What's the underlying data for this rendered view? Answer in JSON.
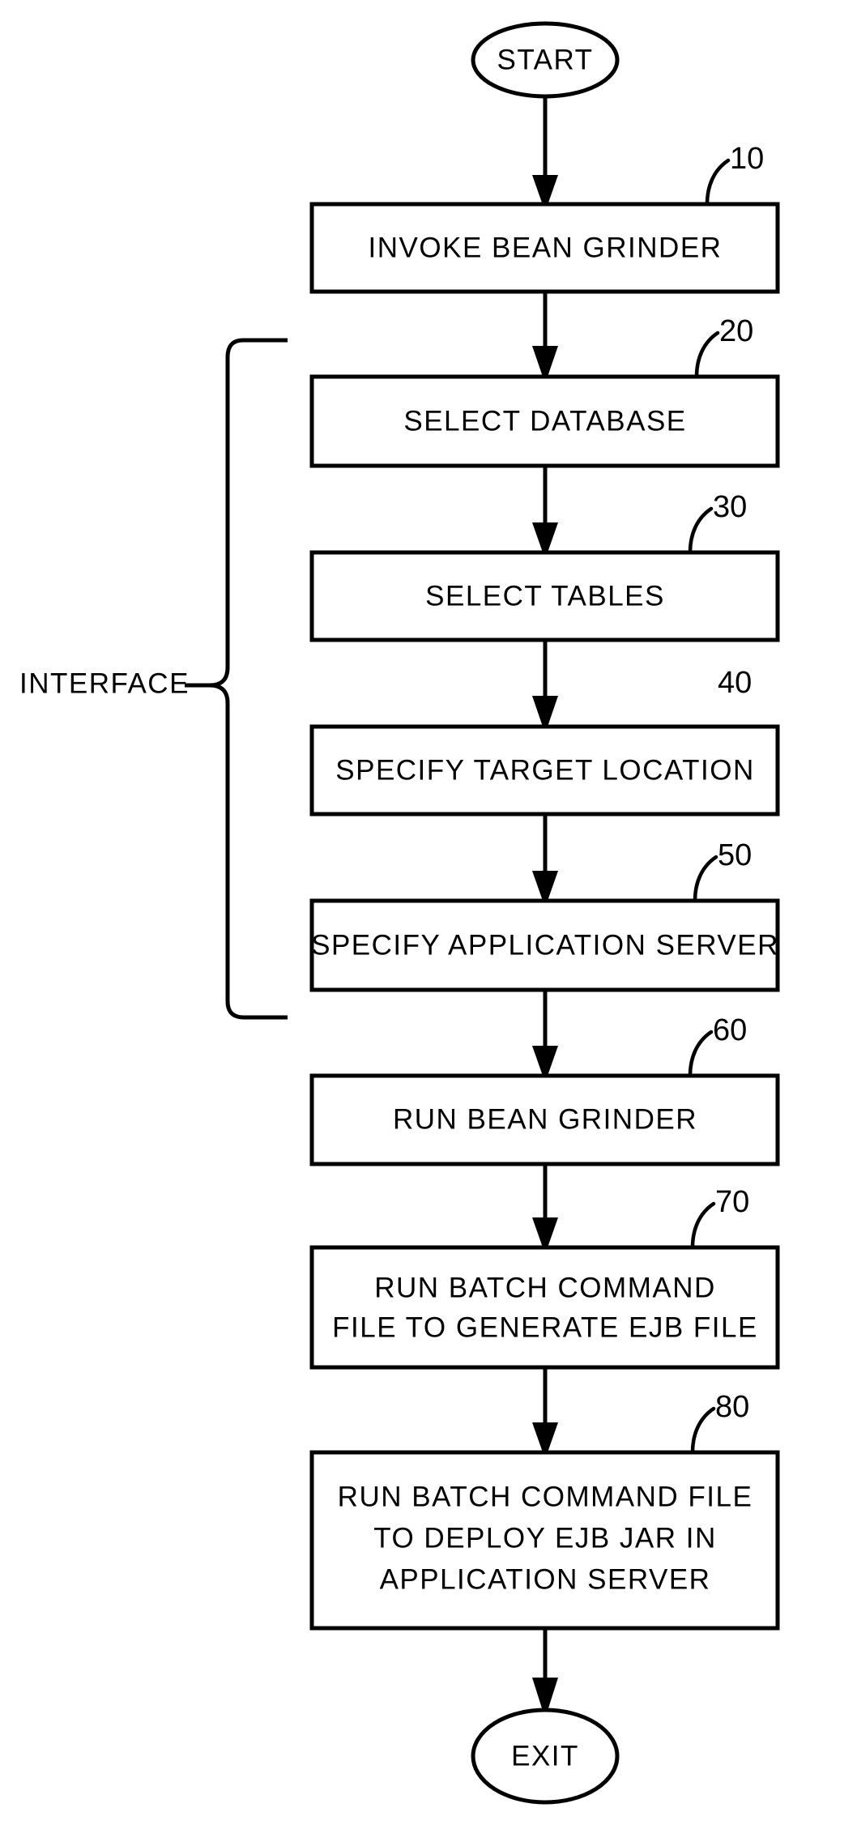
{
  "figure": {
    "type": "flowchart",
    "orientation": "vertical",
    "background_color": "#ffffff",
    "line_color": "#000000"
  },
  "group_annotation": {
    "label": "INTERFACE",
    "covers_steps": [
      "20",
      "30",
      "40",
      "50"
    ]
  },
  "terminals": {
    "start": {
      "label": "START"
    },
    "end": {
      "label": "EXIT"
    }
  },
  "steps": [
    {
      "ref": "10",
      "lines": [
        "INVOKE BEAN GRINDER"
      ],
      "has_leader": true
    },
    {
      "ref": "20",
      "lines": [
        "SELECT DATABASE"
      ],
      "has_leader": true
    },
    {
      "ref": "30",
      "lines": [
        "SELECT TABLES"
      ],
      "has_leader": true
    },
    {
      "ref": "40",
      "lines": [
        "SPECIFY TARGET LOCATION"
      ],
      "has_leader": false
    },
    {
      "ref": "50",
      "lines": [
        "SPECIFY APPLICATION SERVER"
      ],
      "has_leader": true
    },
    {
      "ref": "60",
      "lines": [
        "RUN BEAN GRINDER"
      ],
      "has_leader": true
    },
    {
      "ref": "70",
      "lines": [
        "RUN BATCH COMMAND",
        "FILE TO GENERATE EJB FILE"
      ],
      "has_leader": true
    },
    {
      "ref": "80",
      "lines": [
        "RUN BATCH COMMAND FILE",
        "TO DEPLOY EJB JAR IN",
        "APPLICATION SERVER"
      ],
      "has_leader": true
    }
  ]
}
